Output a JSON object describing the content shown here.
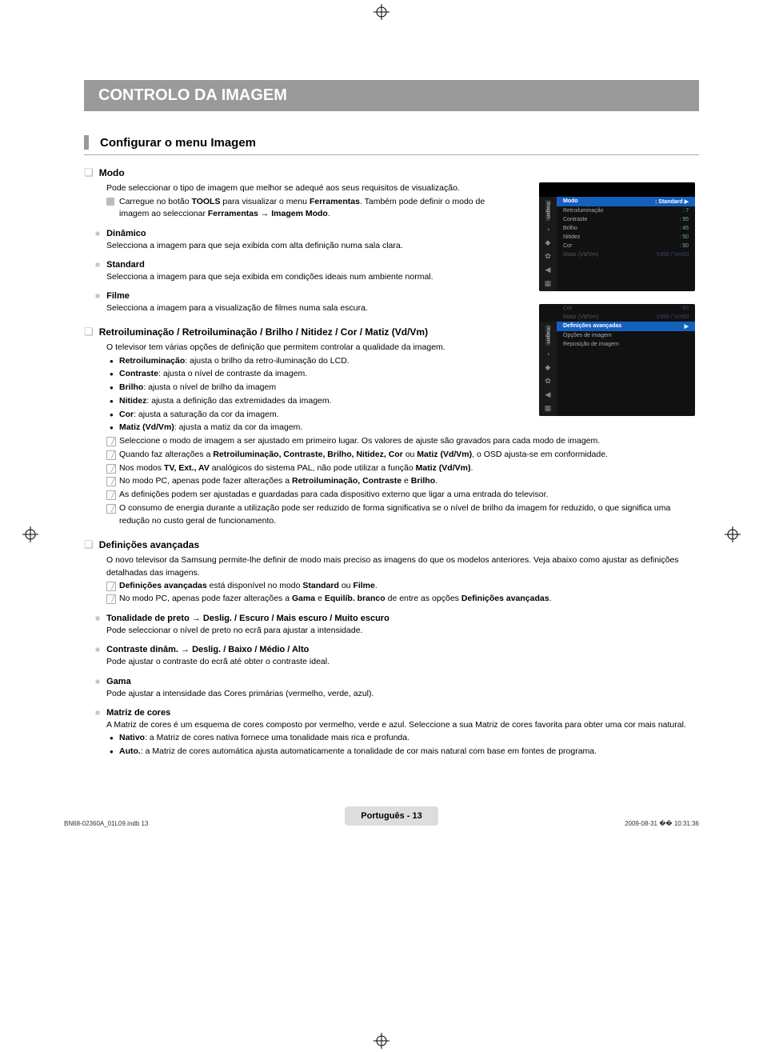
{
  "print_marks": {
    "glyph": "⊕"
  },
  "title_banner": "CONTROLO DA IMAGEM",
  "section_header": "Configurar o menu Imagem",
  "modo": {
    "title": "Modo",
    "intro": "Pode seleccionar o tipo de imagem que melhor se adequé aos seus requisitos de visualização.",
    "tool_line": "Carregue no botão TOOLS para visualizar o menu Ferramentas. Também pode definir o modo de imagem ao seleccionar Ferramentas → Imagem Modo.",
    "dinamico_title": "Dinâmico",
    "dinamico_text": "Selecciona a imagem para que seja exibida com alta definição numa sala clara.",
    "standard_title": "Standard",
    "standard_text": "Selecciona a imagem para que seja exibida em condições ideais num ambiente normal.",
    "filme_title": "Filme",
    "filme_text": "Selecciona a imagem para a visualização de filmes numa sala escura."
  },
  "retro": {
    "title": "Retroiluminação / Retroiluminação / Brilho / Nitidez / Cor / Matiz (Vd/Vm)",
    "intro": "O televisor tem várias opções de definição que permitem controlar a qualidade da imagem.",
    "b1": "Retroiluminação: ajusta o brilho da retro-iluminação do LCD.",
    "b2": "Contraste: ajusta o nível de contraste da imagem.",
    "b3": "Brilho: ajusta o nível de brilho da imagem",
    "b4": "Nitidez: ajusta a definição das extremidades da imagem.",
    "b5": "Cor: ajusta a saturação da cor da imagem.",
    "b6": "Matiz (Vd/Vm): ajusta a matiz da cor da imagem.",
    "n1": "Seleccione o modo de imagem a ser ajustado em primeiro lugar. Os valores de ajuste são gravados para cada modo de imagem.",
    "n2": "Quando faz alterações a Retroiluminação, Contraste, Brilho, Nitidez, Cor ou Matiz (Vd/Vm), o OSD ajusta-se em conformidade.",
    "n3": "Nos modos TV, Ext., AV analógicos do sistema PAL, não pode utilizar a função Matiz (Vd/Vm).",
    "n4": "No modo PC, apenas pode fazer alterações a Retroiluminação, Contraste e Brilho.",
    "n5": "As definições podem ser ajustadas e guardadas para cada dispositivo externo que ligar a uma entrada do televisor.",
    "n6": "O consumo de energia durante a utilização pode ser reduzido de forma significativa se o nível de brilho da imagem for reduzido, o que significa uma redução no custo geral de funcionamento."
  },
  "avancadas": {
    "title": "Definições avançadas",
    "intro": "O novo televisor da Samsung permite-lhe definir de modo mais preciso as imagens do que os modelos anteriores. Veja abaixo como ajustar as definições detalhadas das imagens.",
    "n1": "Definições avançadas está disponível no modo Standard ou Filme.",
    "n2": "No modo PC, apenas pode fazer alterações a Gama e Equilíb. branco de entre as opções Definições avançadas.",
    "ton_title": "Tonalidade de preto → Deslig. / Escuro / Mais escuro / Muito escuro",
    "ton_text": "Pode seleccionar o nível de preto no ecrã para ajustar a intensidade.",
    "contraste_title": "Contraste dinâm. → Deslig. / Baixo / Médio / Alto",
    "contraste_text": "Pode ajustar o contraste do ecrã até obter o contraste ideal.",
    "gama_title": "Gama",
    "gama_text": "Pode ajustar a intensidade das Cores primárias (vermelho, verde, azul).",
    "matriz_title": "Matriz de cores",
    "matriz_text": "A Matriz de cores é um esquema de cores composto por vermelho, verde e azul. Seleccione a sua Matriz de cores favorita para obter uma cor mais natural.",
    "matriz_b1": "Nativo: a Matriz de cores nativa fornece uma tonalidade mais rica e profunda.",
    "matriz_b2": "Auto.: a Matriz de cores automática ajusta automaticamente a tonalidade de cor mais natural com base em fontes de programa."
  },
  "osd1": {
    "tab": "Imagem",
    "rows": [
      {
        "label": "Modo",
        "value": ": Standard",
        "hl": true,
        "arrow": "▶"
      },
      {
        "label": "Retroiluminação",
        "value": ": 7"
      },
      {
        "label": "Contraste",
        "value": ": 95"
      },
      {
        "label": "Brilho",
        "value": ": 45"
      },
      {
        "label": "Nitidez",
        "value": ": 50"
      },
      {
        "label": "Cor",
        "value": ": 50"
      },
      {
        "label": "Matiz (Vd/Vm)",
        "value": ": Vd50 / Vm50",
        "dim": true
      }
    ]
  },
  "osd2": {
    "tab": "Imagem",
    "rows_top": [
      {
        "label": "Cor",
        "value": ": 50",
        "dim": true
      },
      {
        "label": "Matiz (Vd/Vm)",
        "value": ": Vd50 / Vm50",
        "dim": true
      }
    ],
    "hl_row": {
      "label": "Definições avançadas",
      "arrow": "▶"
    },
    "rows_bottom": [
      {
        "label": "Opções de imagem",
        "value": ""
      },
      {
        "label": "Reposição de imagem",
        "value": ""
      }
    ]
  },
  "footer": {
    "text": "Português - 13"
  },
  "bottomline": {
    "left": "BN68-02360A_01L09.indb   13",
    "right": "2009-08-31   �� 10:31:36"
  }
}
